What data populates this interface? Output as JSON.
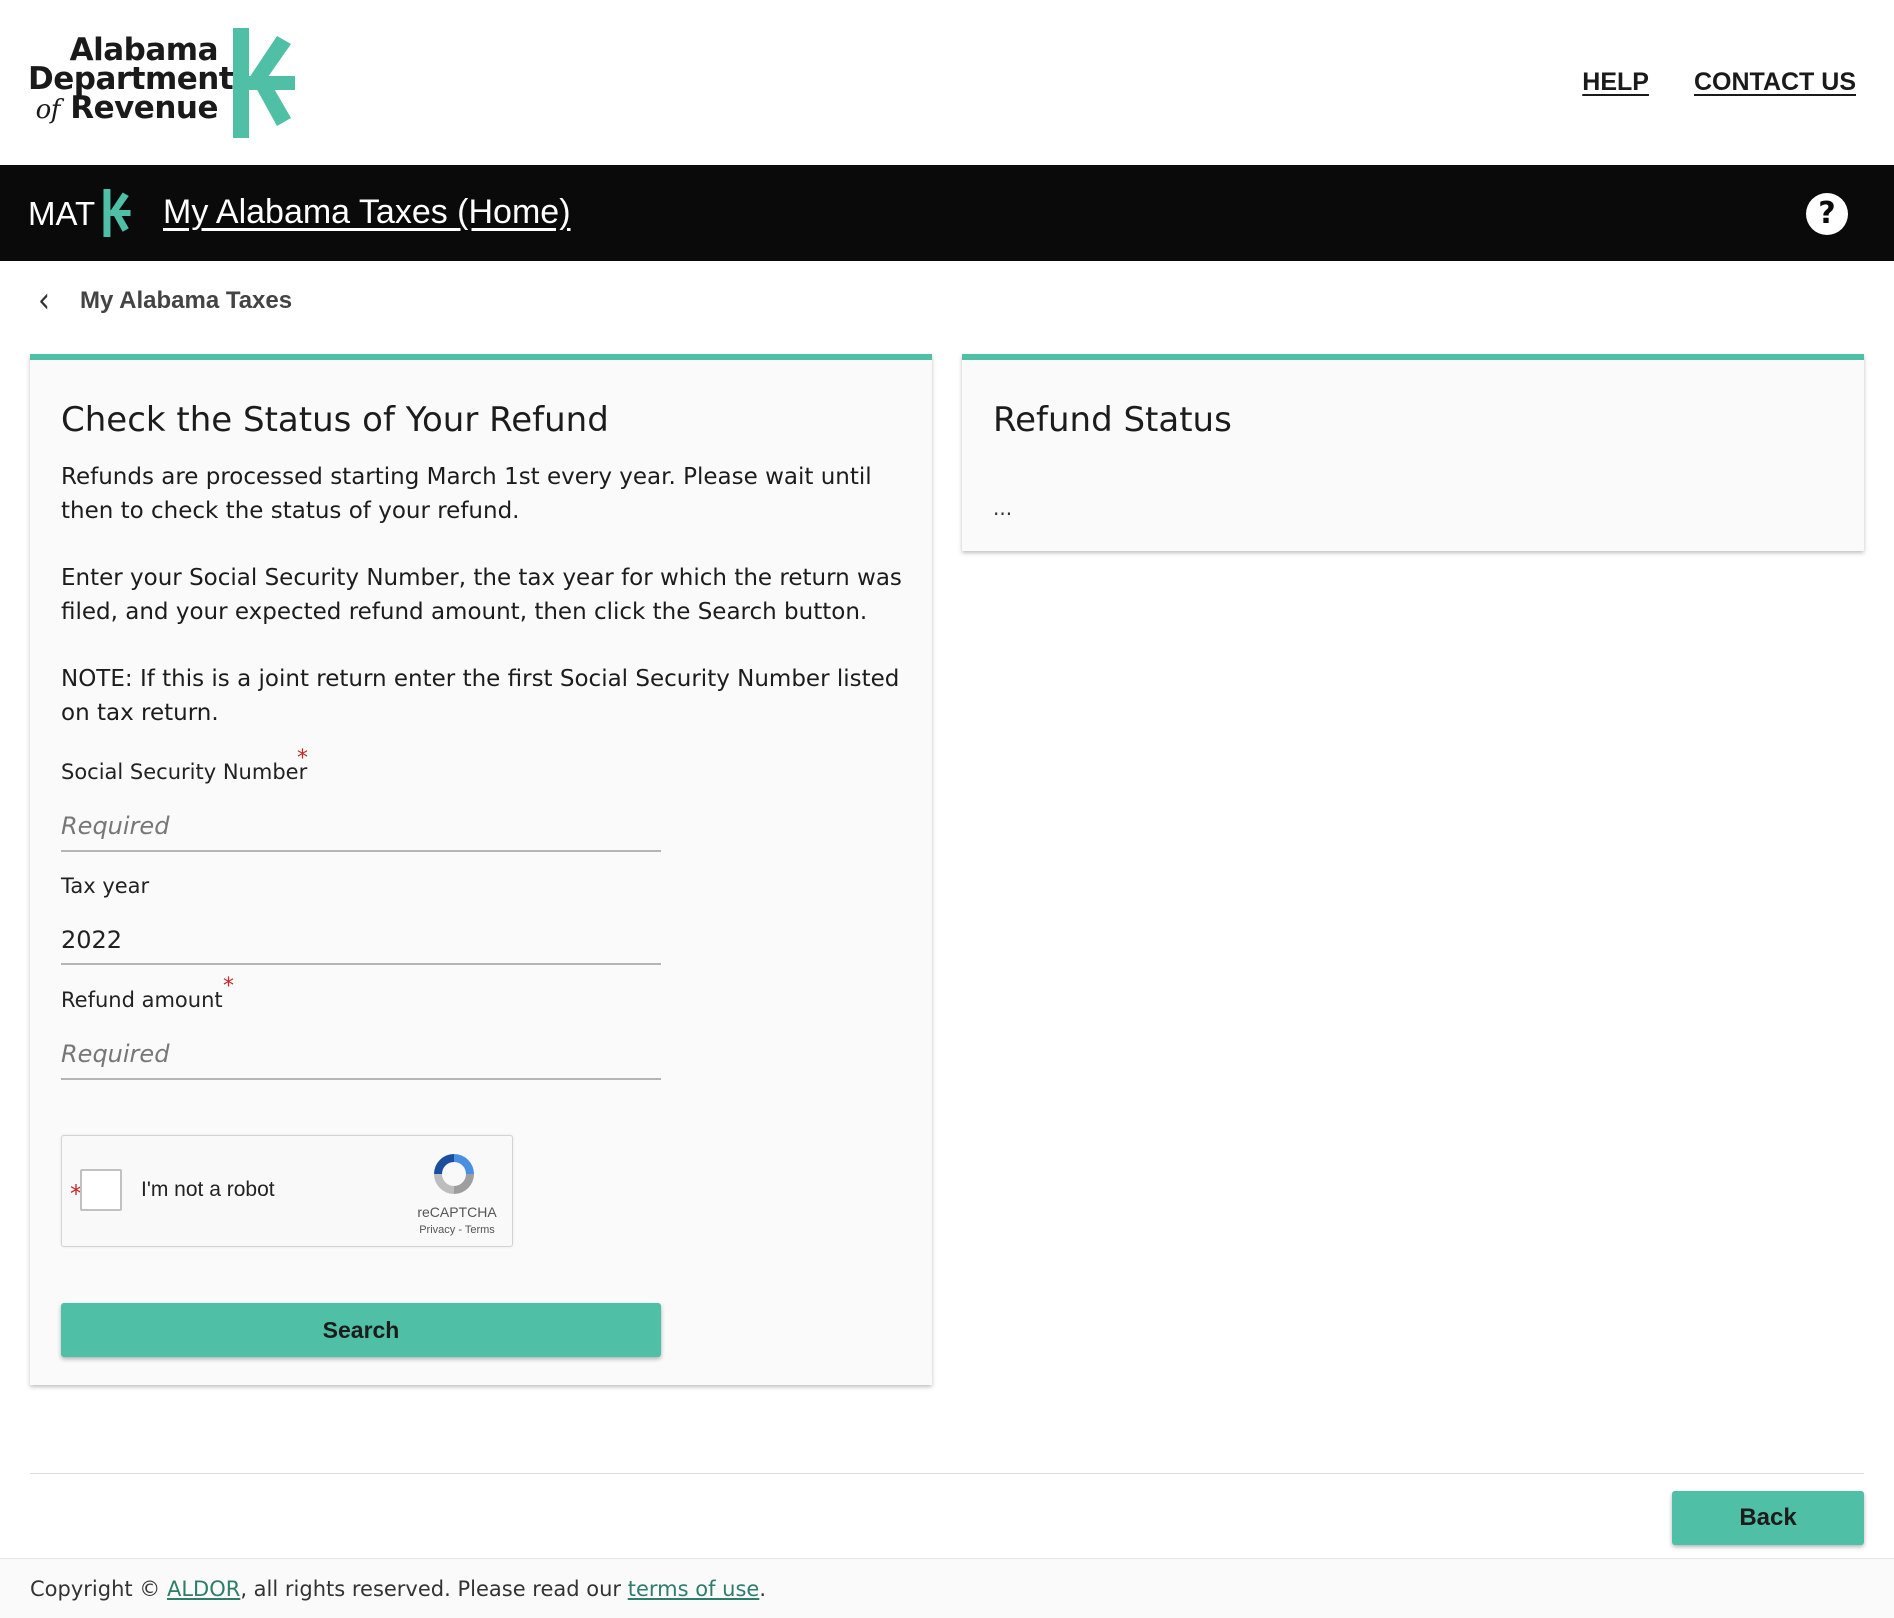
{
  "header": {
    "logo_lines": [
      "Alabama",
      "Department",
      "of",
      "Revenue"
    ],
    "links": [
      "HELP",
      "CONTACT US"
    ]
  },
  "navbar": {
    "app_short": "MAT",
    "home_link": "My Alabama Taxes (Home)",
    "help_icon": "?"
  },
  "breadcrumb": {
    "back_icon": "chevron-left-icon",
    "label": "My Alabama Taxes"
  },
  "form_card": {
    "title": "Check the Status of Your Refund",
    "paragraphs": [
      "Refunds are processed starting March 1st every year. Please wait until then to check the status of your refund.",
      "Enter your Social Security Number, the tax year for which the return was filed, and your expected refund amount, then click the Search button.",
      "NOTE: If this is a joint return enter the first Social Security Number listed on tax return."
    ],
    "fields": {
      "ssn": {
        "label": "Social Security Number",
        "placeholder": "Required",
        "required": true
      },
      "tax_year": {
        "label": "Tax year",
        "value": "2022"
      },
      "refund_amount": {
        "label": "Refund amount",
        "placeholder": "Required",
        "required": true
      }
    },
    "required_mark": "*",
    "captcha": {
      "label": "I'm not a robot",
      "brand": "reCAPTCHA",
      "links": "Privacy - Terms"
    },
    "search_button": "Search"
  },
  "status_card": {
    "title": "Refund Status",
    "content": "..."
  },
  "back_button": "Back",
  "footer": {
    "prefix": "Copyright © ",
    "org_link": "ALDOR",
    "middle": ", all rights reserved. Please read our ",
    "terms_link": "terms of use",
    "suffix": "."
  },
  "colors": {
    "accent": "#4fbfa5",
    "navbar_bg": "#0a0a0a",
    "required": "#c62828"
  }
}
